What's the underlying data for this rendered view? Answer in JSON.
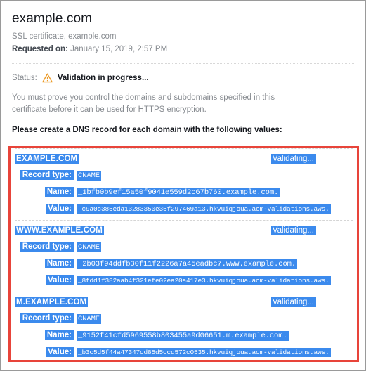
{
  "certificate": {
    "title": "example.com",
    "subtitle": "SSL certificate, example.com",
    "requested_label": "Requested on:",
    "requested_on": "January 15, 2019, 2:57 PM",
    "status_label": "Status:",
    "status_value": "Validation in progress...",
    "status_icon": "warning-triangle-icon",
    "status_color": "#ec9a26",
    "explanation": "You must prove you control the domains and subdomains specified in this certificate before it can be used for HTTPS encryption.",
    "instruction": "Please create a DNS record for each domain with the following values:"
  },
  "labels": {
    "record_type": "Record type:",
    "name": "Name:",
    "value": "Value:"
  },
  "selection_color": "#3b8aed",
  "annotation_color": "#e8443a",
  "domains": [
    {
      "domain": "EXAMPLE.COM",
      "state": "Validating...",
      "record_type": "CNAME",
      "name": "_1bfb0b9ef15a50f9041e559d2c67b760.example.com.",
      "value": "_c9a0c385eda13283350e35f297469a13.hkvuiqjoua.acm-validations.aws."
    },
    {
      "domain": "WWW.EXAMPLE.COM",
      "state": "Validating...",
      "record_type": "CNAME",
      "name": "_2b03f94ddfb30f11f2226a7a45eadbc7.www.example.com.",
      "value": "_8fdd1f382aab4f321efe02ea20a417e3.hkvuiqjoua.acm-validations.aws."
    },
    {
      "domain": "M.EXAMPLE.COM",
      "state": "Validating...",
      "record_type": "CNAME",
      "name": "_9152f41cfd5969558b803455a9d06651.m.example.com.",
      "value": "_b3c5d5f44a47347cd85d5ccd572c0535.hkvuiqjoua.acm-validations.aws."
    }
  ]
}
